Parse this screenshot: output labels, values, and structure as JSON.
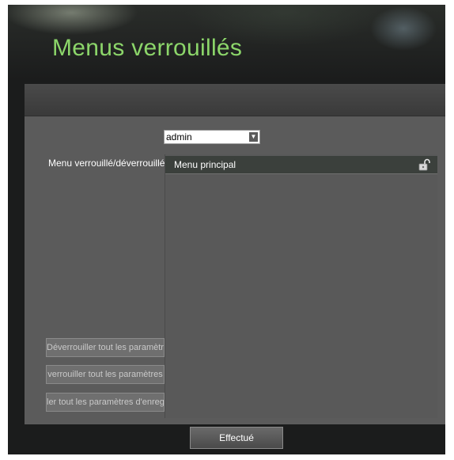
{
  "window": {
    "title": "Menus verrouillés"
  },
  "form": {
    "user_select_value": "admin",
    "lock_label": "Menu verrouillé/déverrouillé"
  },
  "menu_list": {
    "items": [
      {
        "label": "Menu principal",
        "icon": "unlocked-padlock-icon"
      }
    ]
  },
  "buttons": {
    "unlock_all": "Déverrouiller tout les paramètres",
    "lock_all": "verrouiller tout les paramètres",
    "all_record": "ler tout les paramètres d'enregis",
    "done": "Effectué"
  },
  "colors": {
    "title_green": "#8cd66a",
    "panel_gray": "#5b5b5b",
    "row_dark": "#3b403c"
  }
}
